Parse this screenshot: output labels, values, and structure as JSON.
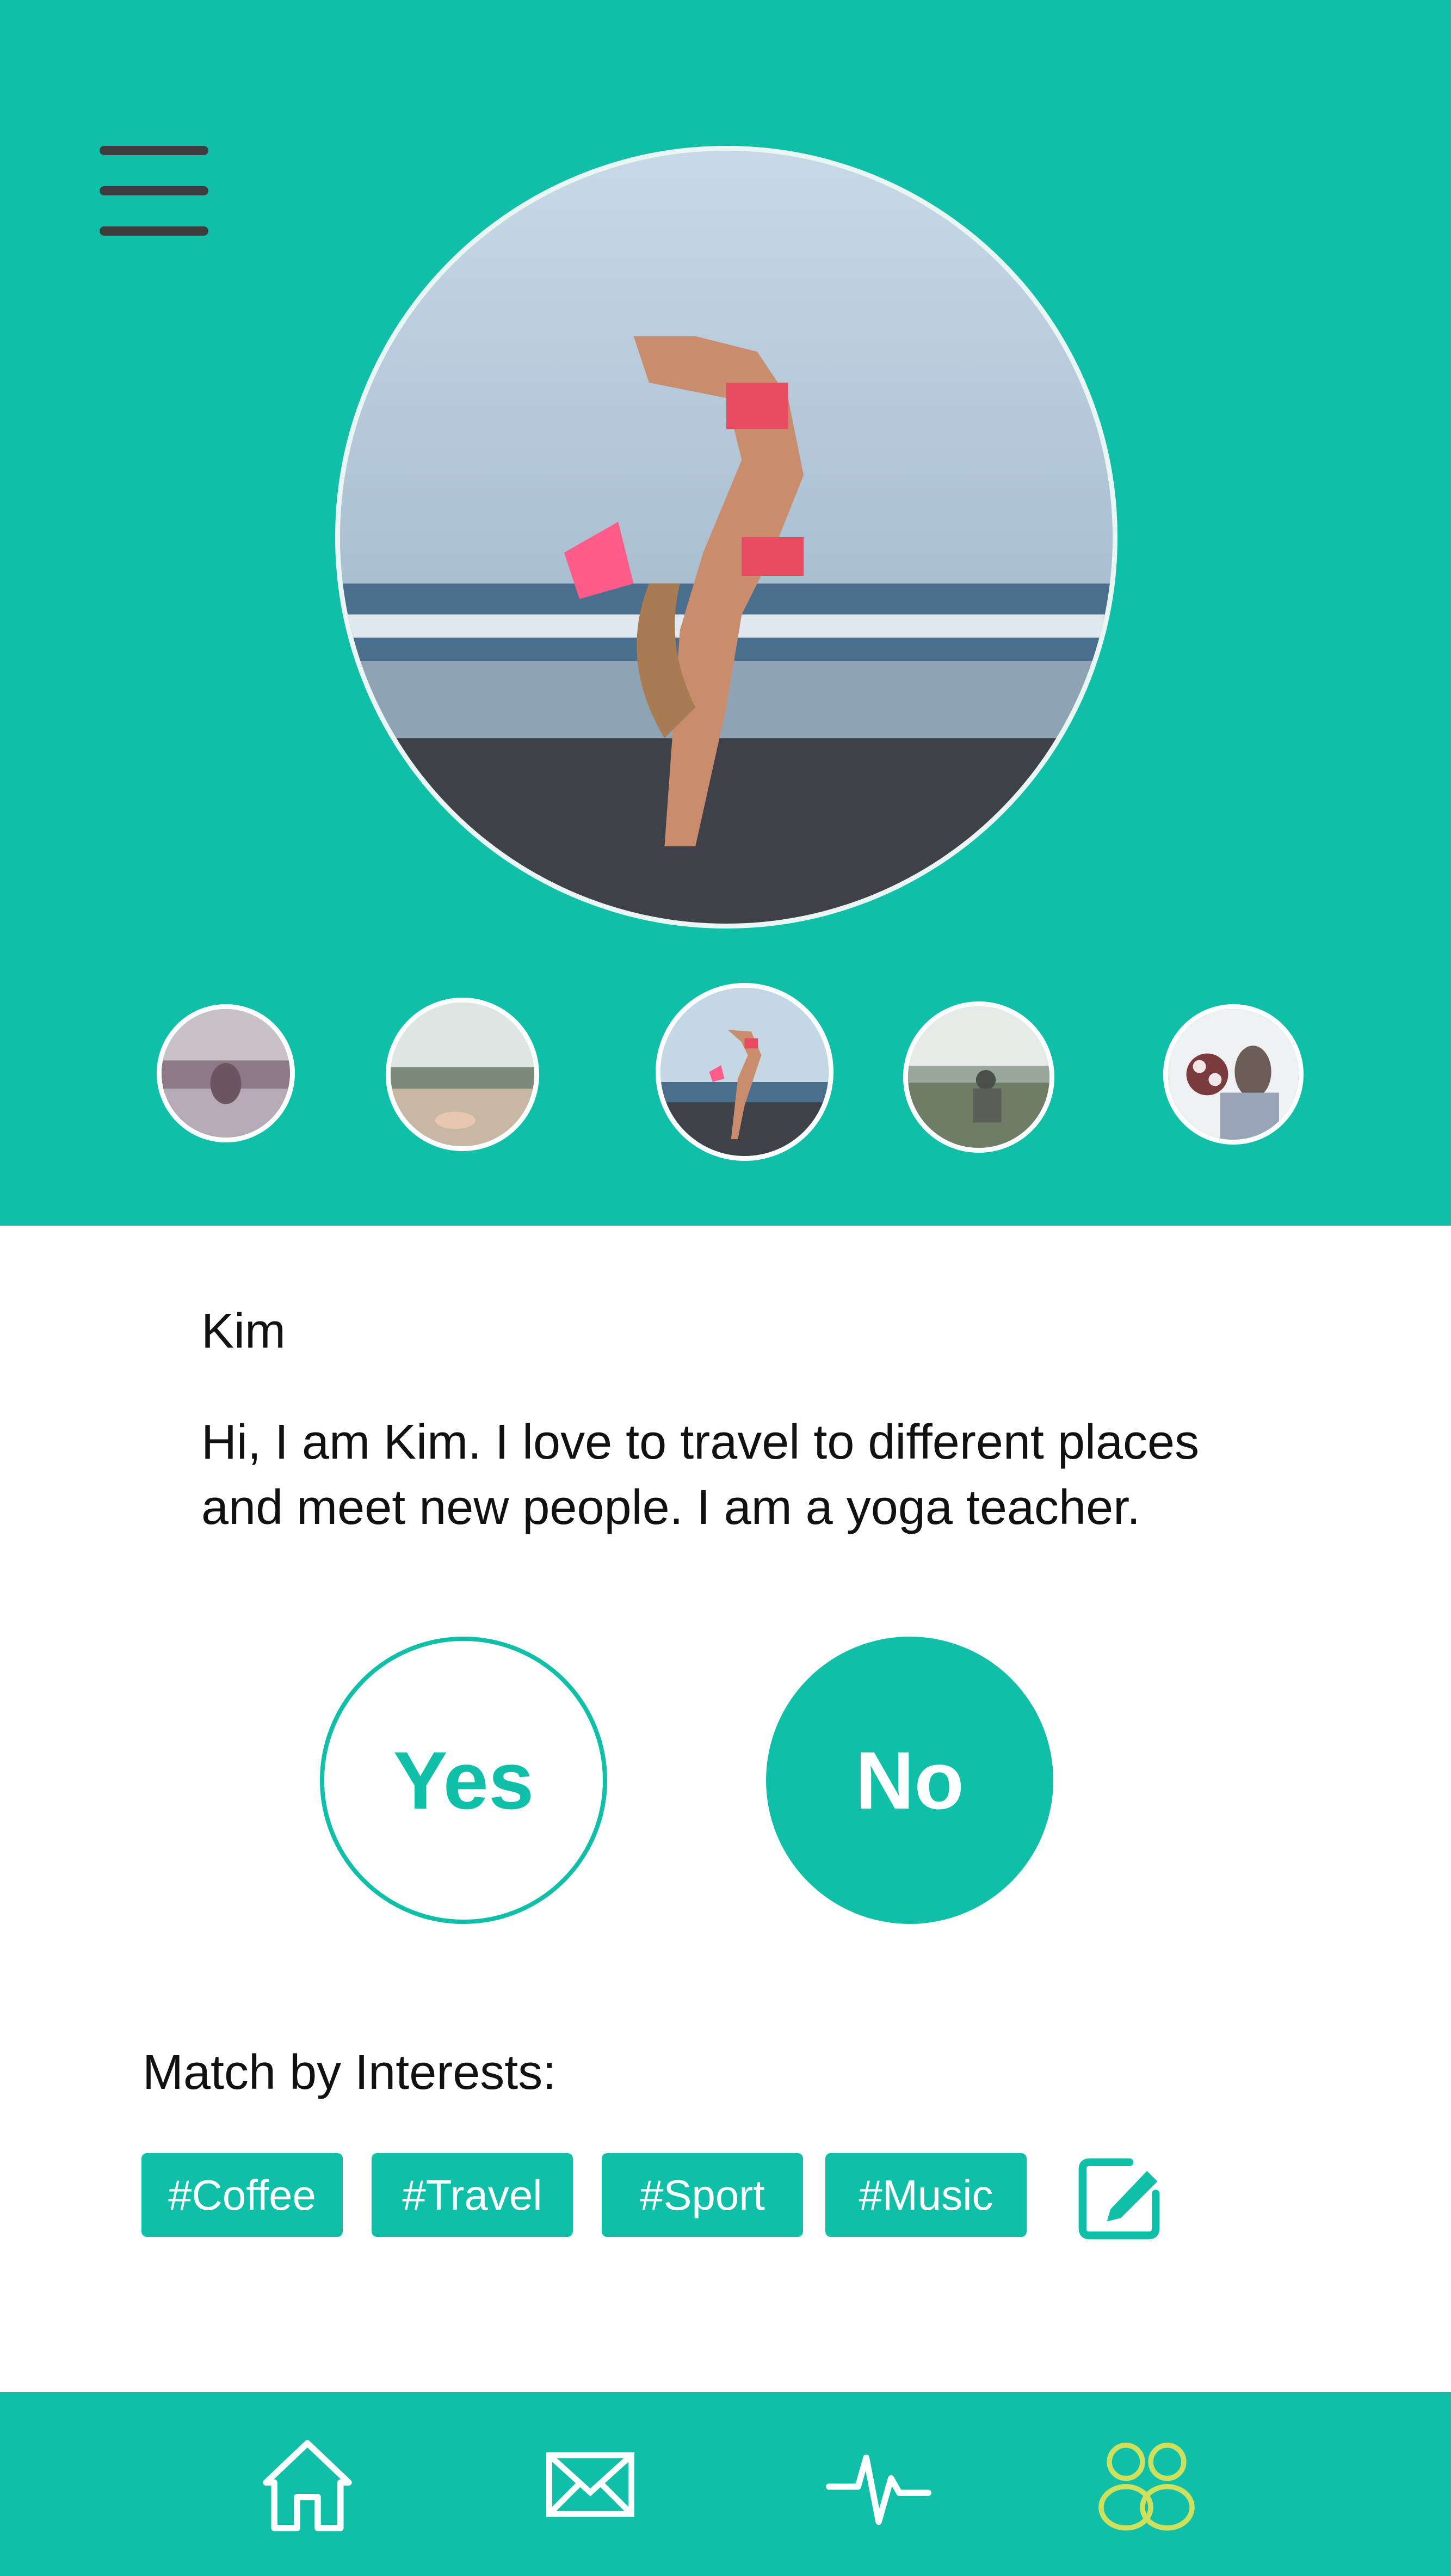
{
  "header": {
    "menu_icon": "hamburger-menu-icon",
    "main_photo": "yoga-beach-scorpion-pose-photo",
    "thumbnails": [
      "yoga-lake-photo",
      "feet-mountain-view-photo",
      "yoga-beach-photo",
      "hillside-view-photo",
      "friends-with-flowers-photo"
    ],
    "selected_thumbnail_index": 2
  },
  "profile": {
    "name": "Kim",
    "bio": "Hi, I am Kim. I love to travel to different places and meet new people. I am a yoga teacher."
  },
  "actions": {
    "yes_label": "Yes",
    "no_label": "No"
  },
  "interests": {
    "label": "Match by Interests:",
    "tags": [
      "#Coffee",
      "#Travel",
      "#Sport",
      "#Music"
    ],
    "edit_icon": "edit-icon"
  },
  "tabbar": {
    "items": [
      "home-icon",
      "mail-icon",
      "activity-icon",
      "people-icon"
    ],
    "active_index": 3
  },
  "colors": {
    "primary": "#10bfa8",
    "active_tab": "#cfe05c",
    "text": "#111111"
  }
}
